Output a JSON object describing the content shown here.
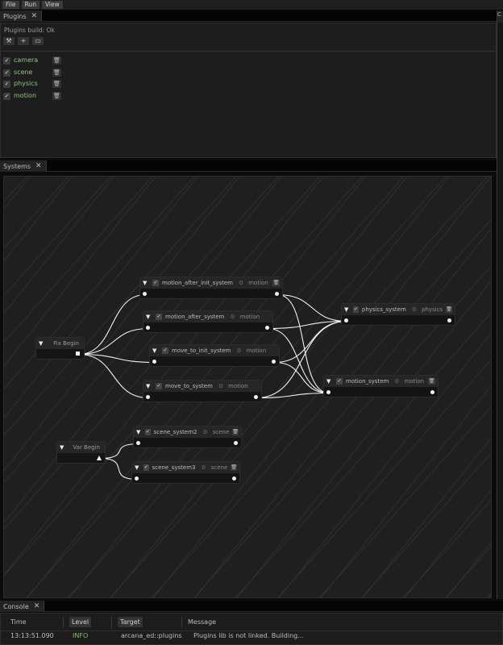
{
  "menubar": {
    "items": [
      "File",
      "Run",
      "View"
    ]
  },
  "plugins_panel": {
    "tab_label": "Plugins",
    "close_glyph": "✕",
    "status": "Plugins build: Ok",
    "toolbar": {
      "build_icon": "hammer-icon",
      "add_icon": "plus-icon",
      "reload_icon": "run-icon"
    },
    "items": [
      {
        "name": "camera",
        "checked": true
      },
      {
        "name": "scene",
        "checked": true
      },
      {
        "name": "physics",
        "checked": true
      },
      {
        "name": "motion",
        "checked": true
      }
    ]
  },
  "systems_panel": {
    "tab_label": "Systems",
    "close_glyph": "✕",
    "begin_nodes": [
      {
        "id": "fix",
        "title": "Fix Begin"
      },
      {
        "id": "var",
        "title": "Var Begin"
      }
    ],
    "nodes": [
      {
        "id": "n1",
        "title": "motion_after_init_system",
        "plugin": "motion"
      },
      {
        "id": "n2",
        "title": "motion_after_system",
        "plugin": "motion"
      },
      {
        "id": "n3",
        "title": "move_to_init_system",
        "plugin": "motion"
      },
      {
        "id": "n4",
        "title": "move_to_system",
        "plugin": "motion"
      },
      {
        "id": "n5",
        "title": "physics_system",
        "plugin": "physics"
      },
      {
        "id": "n6",
        "title": "motion_system",
        "plugin": "motion"
      },
      {
        "id": "n7",
        "title": "scene_system2",
        "plugin": "scene"
      },
      {
        "id": "n8",
        "title": "scene_system3",
        "plugin": "scene"
      }
    ],
    "edges": [
      [
        "fix",
        "n1"
      ],
      [
        "fix",
        "n2"
      ],
      [
        "fix",
        "n3"
      ],
      [
        "fix",
        "n4"
      ],
      [
        "n1",
        "n5"
      ],
      [
        "n1",
        "n6"
      ],
      [
        "n2",
        "n5"
      ],
      [
        "n2",
        "n6"
      ],
      [
        "n3",
        "n5"
      ],
      [
        "n3",
        "n6"
      ],
      [
        "n4",
        "n5"
      ],
      [
        "n4",
        "n6"
      ],
      [
        "var",
        "n7"
      ],
      [
        "var",
        "n8"
      ]
    ],
    "colors": {
      "wire": "#f2f2f2",
      "grid": "#343434",
      "canvas": "#1f1f1f"
    }
  },
  "console_panel": {
    "tab_label": "Console",
    "close_glyph": "✕",
    "columns": {
      "time": "Time",
      "level": "Level",
      "target": "Target",
      "message": "Message"
    },
    "rows": [
      {
        "time": "13:13:51.090",
        "level": "INFO",
        "target": "arcana_ed::plugins",
        "message": "Plugins lib is not linked. Building..."
      }
    ]
  }
}
